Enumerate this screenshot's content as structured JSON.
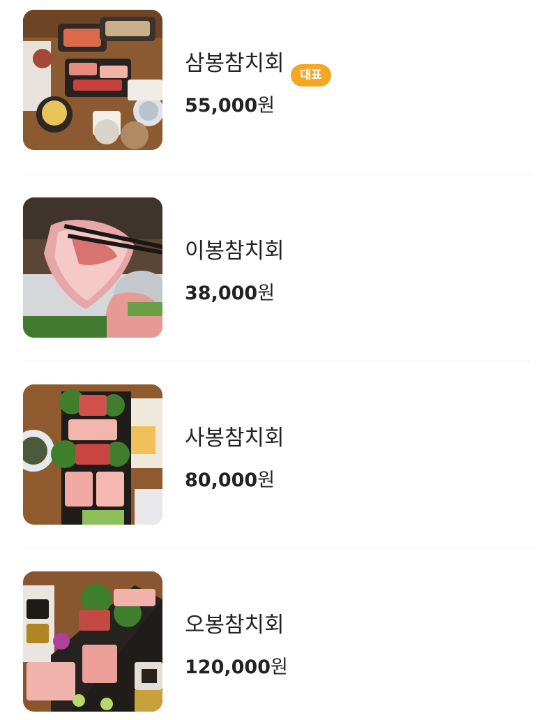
{
  "menu": {
    "items": [
      {
        "name": "삼봉참치회",
        "badge": "대표",
        "price_number": "55,000",
        "price_unit": "원",
        "image": "tuna-set-table-photo"
      },
      {
        "name": "이봉참치회",
        "badge": null,
        "price_number": "38,000",
        "price_unit": "원",
        "image": "tuna-slice-chopsticks-photo"
      },
      {
        "name": "사봉참치회",
        "badge": null,
        "price_number": "80,000",
        "price_unit": "원",
        "image": "tuna-platter-photo"
      },
      {
        "name": "오봉참치회",
        "badge": null,
        "price_number": "120,000",
        "price_unit": "원",
        "image": "tuna-large-platter-photo"
      }
    ]
  },
  "colors": {
    "badge_bg": "#f5a623",
    "badge_text": "#ffffff",
    "text": "#222222",
    "divider": "#ececec"
  }
}
